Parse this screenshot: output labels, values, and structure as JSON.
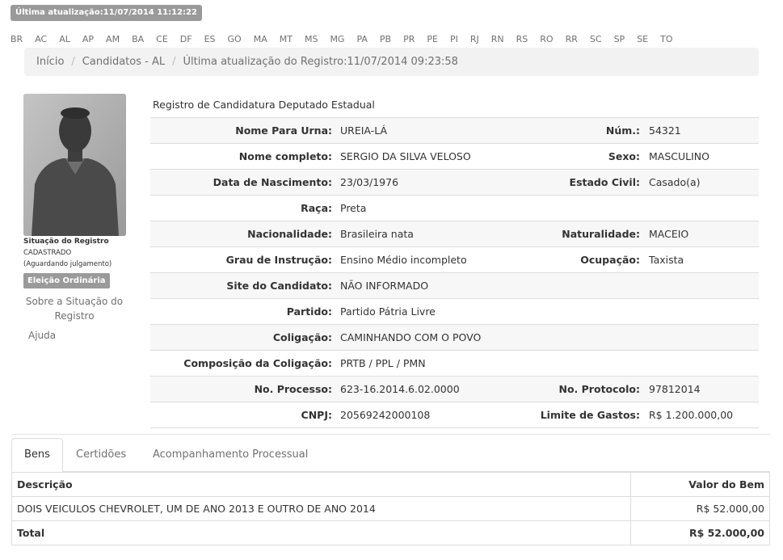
{
  "header": {
    "last_update": "Última atualização:11/07/2014 11:12:22"
  },
  "states": [
    "BR",
    "AC",
    "AL",
    "AP",
    "AM",
    "BA",
    "CE",
    "DF",
    "ES",
    "GO",
    "MA",
    "MT",
    "MS",
    "MG",
    "PA",
    "PB",
    "PR",
    "PE",
    "PI",
    "RJ",
    "RN",
    "RS",
    "RO",
    "RR",
    "SC",
    "SP",
    "SE",
    "TO"
  ],
  "breadcrumb": {
    "home": "Início",
    "candidates": "Candidatos - AL",
    "record_update": "Última atualização do Registro:11/07/2014 09:23:58"
  },
  "sidebar": {
    "status_heading": "Situação do Registro",
    "status_value": "CADASTRADO",
    "status_sub": "(Aguardando julgamento)",
    "election_badge": "Eleição Ordinária",
    "about_link": "Sobre a Situação do Registro",
    "help_link": "Ajuda"
  },
  "register_title": "Registro de Candidatura Deputado Estadual",
  "details": [
    {
      "label": "Nome Para Urna:",
      "value": "UREIA-LÁ",
      "label2": "Núm.:",
      "value2": "54321"
    },
    {
      "label": "Nome completo:",
      "value": "SERGIO DA SILVA VELOSO",
      "label2": "Sexo:",
      "value2": "MASCULINO"
    },
    {
      "label": "Data de Nascimento:",
      "value": "23/03/1976",
      "label2": "Estado Civil:",
      "value2": "Casado(a)"
    },
    {
      "label": "Raça:",
      "value": "Preta",
      "label2": "",
      "value2": ""
    },
    {
      "label": "Nacionalidade:",
      "value": "Brasileira nata",
      "label2": "Naturalidade:",
      "value2": "MACEIO"
    },
    {
      "label": "Grau de Instrução:",
      "value": "Ensino Médio incompleto",
      "label2": "Ocupação:",
      "value2": "Taxista"
    },
    {
      "label": "Site do Candidato:",
      "value": "NÃO INFORMADO",
      "label2": "",
      "value2": ""
    },
    {
      "label": "Partido:",
      "value": "Partido Pátria Livre",
      "label2": "",
      "value2": ""
    },
    {
      "label": "Coligação:",
      "value": "CAMINHANDO COM O POVO",
      "label2": "",
      "value2": ""
    },
    {
      "label": "Composição da Coligação:",
      "value": "PRTB / PPL / PMN",
      "label2": "",
      "value2": ""
    },
    {
      "label": "No. Processo:",
      "value": "623-16.2014.6.02.0000",
      "label2": "No. Protocolo:",
      "value2": "97812014"
    },
    {
      "label": "CNPJ:",
      "value": "20569242000108",
      "label2": "Limite de Gastos:",
      "value2": "R$ 1.200.000,00"
    }
  ],
  "tabs": [
    "Bens",
    "Certidões",
    "Acompanhamento Processual"
  ],
  "assets": {
    "headers": [
      "Descrição",
      "Valor do Bem"
    ],
    "rows": [
      {
        "description": "DOIS VEICULOS CHEVROLET, UM DE ANO 2013 E OUTRO DE ANO 2014",
        "value": "R$ 52.000,00"
      }
    ],
    "total_label": "Total",
    "total_value": "R$ 52.000,00"
  }
}
